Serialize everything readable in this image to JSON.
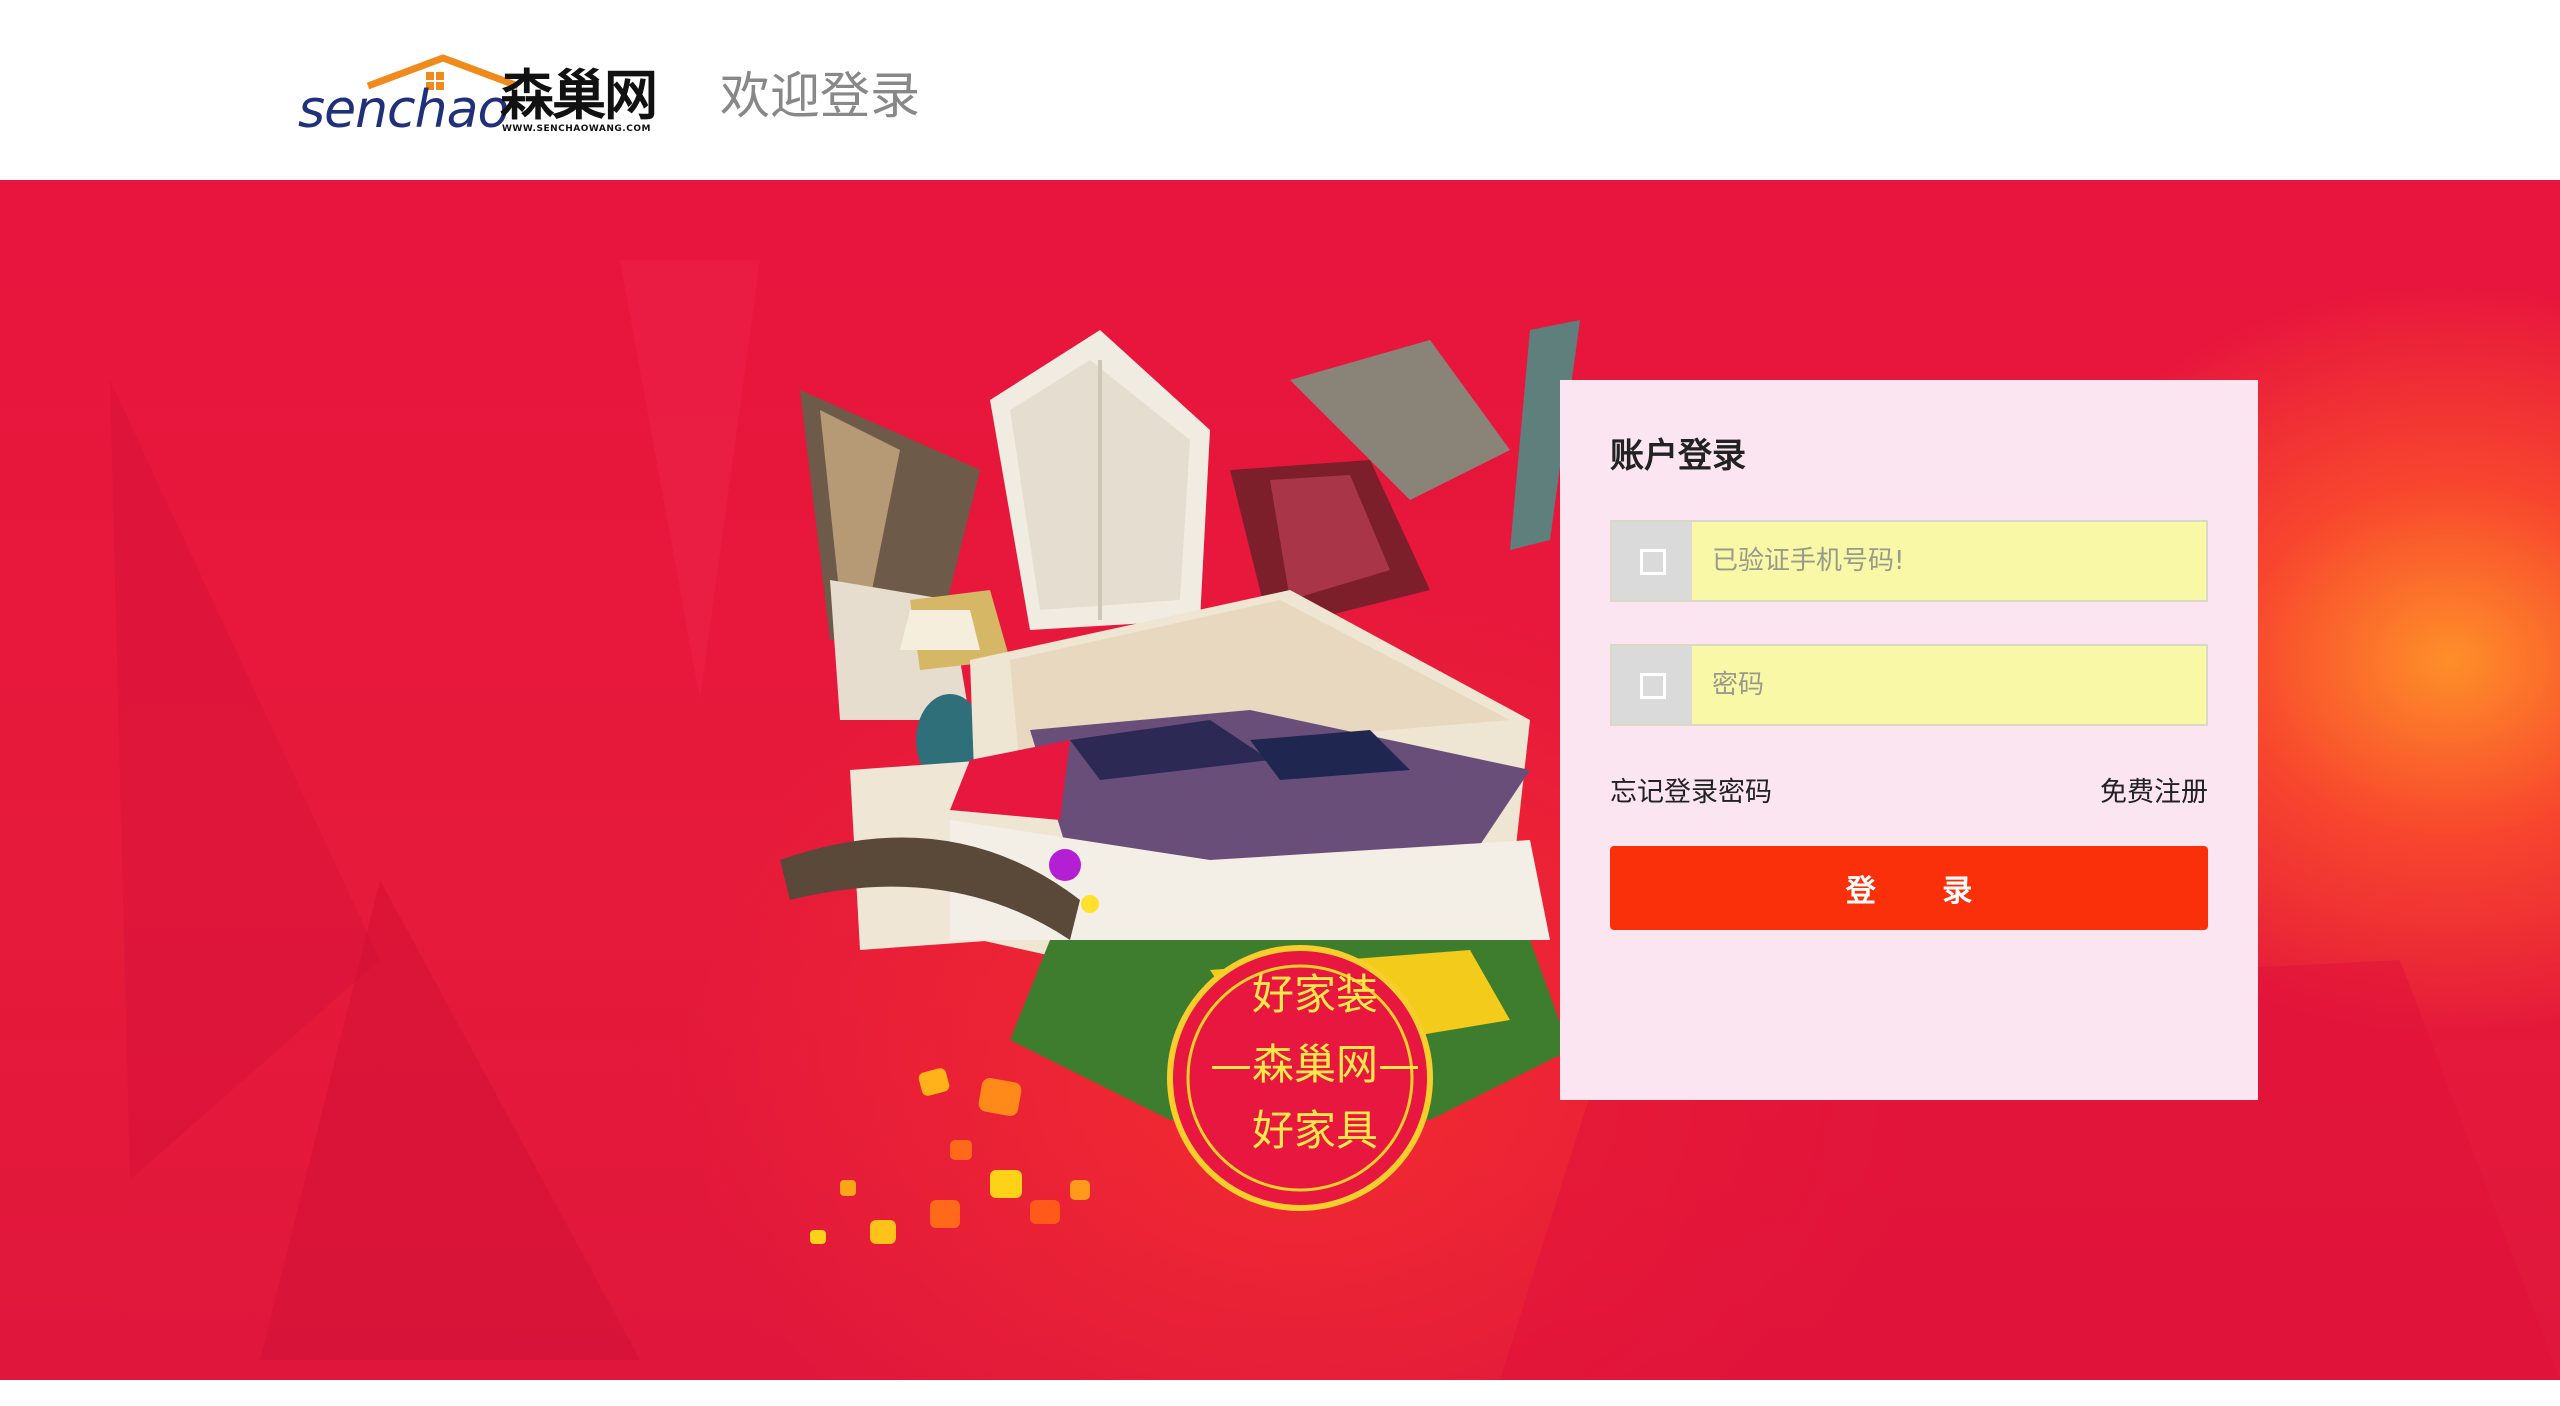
{
  "header": {
    "logo_en": "senchao",
    "logo_cn": "森巢网",
    "logo_url": "WWW.SENCHAOWANG.COM",
    "welcome": "欢迎登录"
  },
  "banner": {
    "badge_line1": "好家装",
    "badge_line2": "—森巢网—",
    "badge_line3": "好家具"
  },
  "login": {
    "title": "账户登录",
    "phone_placeholder": "已验证手机号码!",
    "password_placeholder": "密码",
    "forgot_label": "忘记登录密码",
    "register_label": "免费注册",
    "submit_label": "登  录"
  },
  "icons": {
    "phone_field": "square-outline-icon",
    "password_field": "square-outline-icon"
  },
  "colors": {
    "banner_red": "#e8153e",
    "login_button": "#f9300a",
    "card_background": "#fbe5f1",
    "input_background": "#f8f8a6",
    "brand_navy": "#20307a",
    "logo_orange": "#f08a1a"
  }
}
